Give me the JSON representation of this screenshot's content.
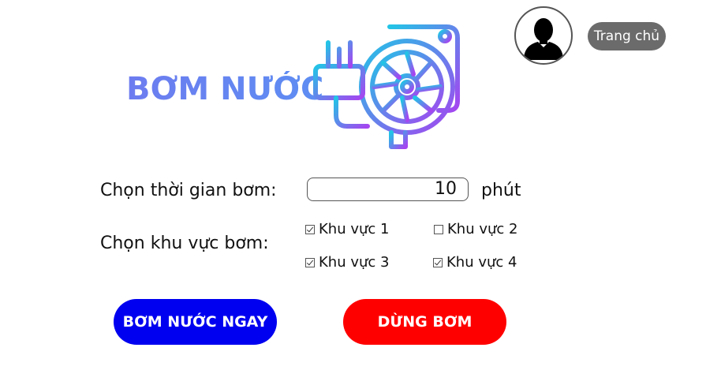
{
  "header": {
    "title": "BƠM NƯỚC",
    "home_label": "Trang chủ",
    "avatar_icon": "user-silhouette-icon",
    "pump_icon": "water-pump-icon",
    "title_color": "#6a80f0",
    "icon_gradient": [
      "#22c4e6",
      "#a545f0"
    ]
  },
  "form": {
    "time_label": "Chọn thời gian bơm:",
    "time_value": "10",
    "time_unit": "phút",
    "area_label": "Chọn khu vực bơm:",
    "areas": [
      {
        "label": "Khu vực 1",
        "checked": true
      },
      {
        "label": "Khu vực 2",
        "checked": false
      },
      {
        "label": "Khu vực 3",
        "checked": true
      },
      {
        "label": "Khu vực 4",
        "checked": true
      }
    ]
  },
  "actions": {
    "start_label": "BƠM NƯỚC NGAY",
    "stop_label": "DỪNG BƠM",
    "start_color": "#0000f0",
    "stop_color": "#ff0000"
  }
}
